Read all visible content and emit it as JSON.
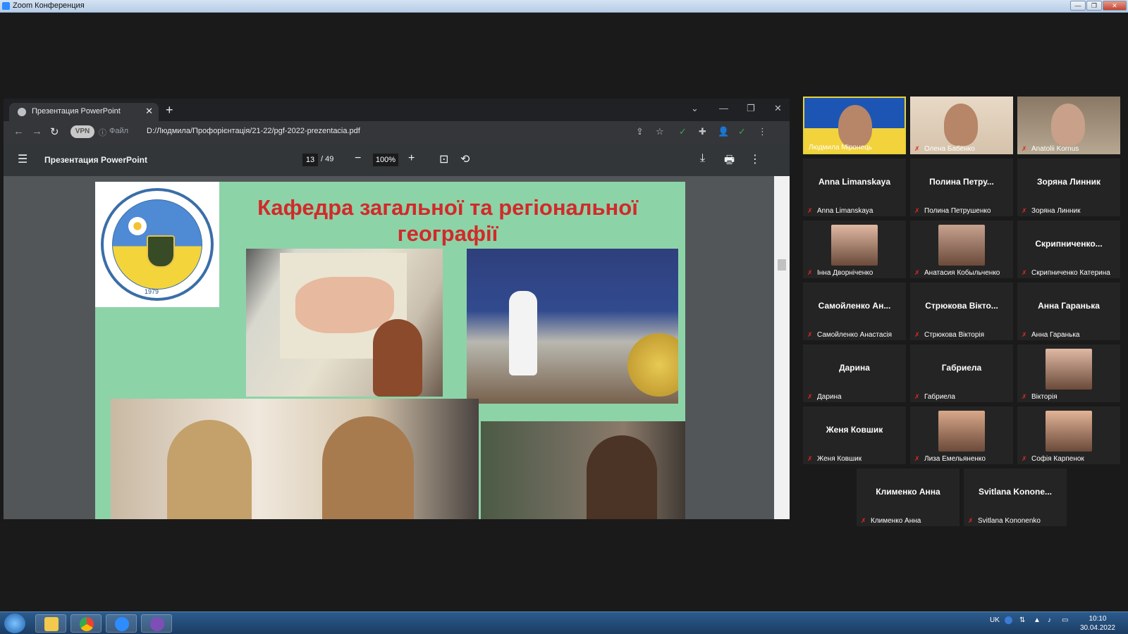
{
  "zoom_window": {
    "title": "Zoom Конференция",
    "minimize": "—",
    "restore": "❐",
    "close": "✕"
  },
  "browser": {
    "tab_title": "Презентация PowerPoint",
    "tab_close": "✕",
    "new_tab": "+",
    "tabstrip_controls": {
      "dropdown": "⌄",
      "minimize": "—",
      "restore": "❐",
      "close": "✕"
    },
    "nav": {
      "back": "←",
      "forward": "→",
      "reload": "↻"
    },
    "vpn_badge": "VPN",
    "info_icon": "ⓘ",
    "file_label": "Файл",
    "url": "D:/Людмила/Профорієнтація/21-22/pgf-2022-prezentacia.pdf",
    "toolbar_icons": {
      "share": "⇪",
      "star": "☆",
      "extension": "✚",
      "profile": "👤",
      "shield": "✓",
      "menu": "⋮"
    }
  },
  "pdf_viewer": {
    "title": "Презентация PowerPoint",
    "menu_icon": "☰",
    "current_page": "13",
    "total_pages": "/ 49",
    "zoom": "100%",
    "zoom_out": "−",
    "zoom_in": "+",
    "fit_icon": "⊡",
    "rotate_icon": "⟲",
    "download_icon": "⤓",
    "print_icon": "🖶",
    "more_icon": "⋮"
  },
  "slide": {
    "title": "Кафедра загальної та регіональної географії",
    "emblem_year": "1979"
  },
  "participants": [
    {
      "name": "Людмила Міронець",
      "video": true,
      "active": true
    },
    {
      "name": "Олена Бабенко",
      "video": true
    },
    {
      "name": "Anatolii Kornus",
      "video": true
    },
    {
      "name": "Anna Limanskaya",
      "display": "Anna Limanskaya"
    },
    {
      "name": "Полина Петрушенко",
      "display": "Полина  Петру..."
    },
    {
      "name": "Зоряна Линник",
      "display": "Зоряна Линник"
    },
    {
      "name": "Інна Дворніченко",
      "avatar": true
    },
    {
      "name": "Анатасия Кобыльченко",
      "avatar": true
    },
    {
      "name": "Скрипниченко Катерина",
      "display": "Скрипниченко..."
    },
    {
      "name": "Самойленко Анастасія",
      "display": "Самойленко  Ан..."
    },
    {
      "name": "Стрюкова Вікторія",
      "display": "Стрюкова  Вікто..."
    },
    {
      "name": "Анна Гаранька",
      "display": "Анна Гаранька"
    },
    {
      "name": "Дарина",
      "display": "Дарина"
    },
    {
      "name": "Габриела",
      "display": "Габриела"
    },
    {
      "name": "Вікторія",
      "avatar": true
    },
    {
      "name": "Женя Ковшик",
      "display": "Женя Ковшик"
    },
    {
      "name": "Лиза Емельяненко",
      "avatar": true
    },
    {
      "name": "Софія Карпенок",
      "avatar": true
    },
    {
      "name": "Клименко Анна",
      "display": "Клименко Анна"
    },
    {
      "name": "Svitlana Kononenko",
      "display": "Svitlana  Konone..."
    }
  ],
  "mic_muted_icon": "✗",
  "taskbar": {
    "language": "UK",
    "time": "10:10",
    "date": "30.04.2022"
  },
  "colors": {
    "slide_bg": "#8dd3a8",
    "slide_title": "#d12a2a",
    "active_speaker": "#e5d33a"
  }
}
